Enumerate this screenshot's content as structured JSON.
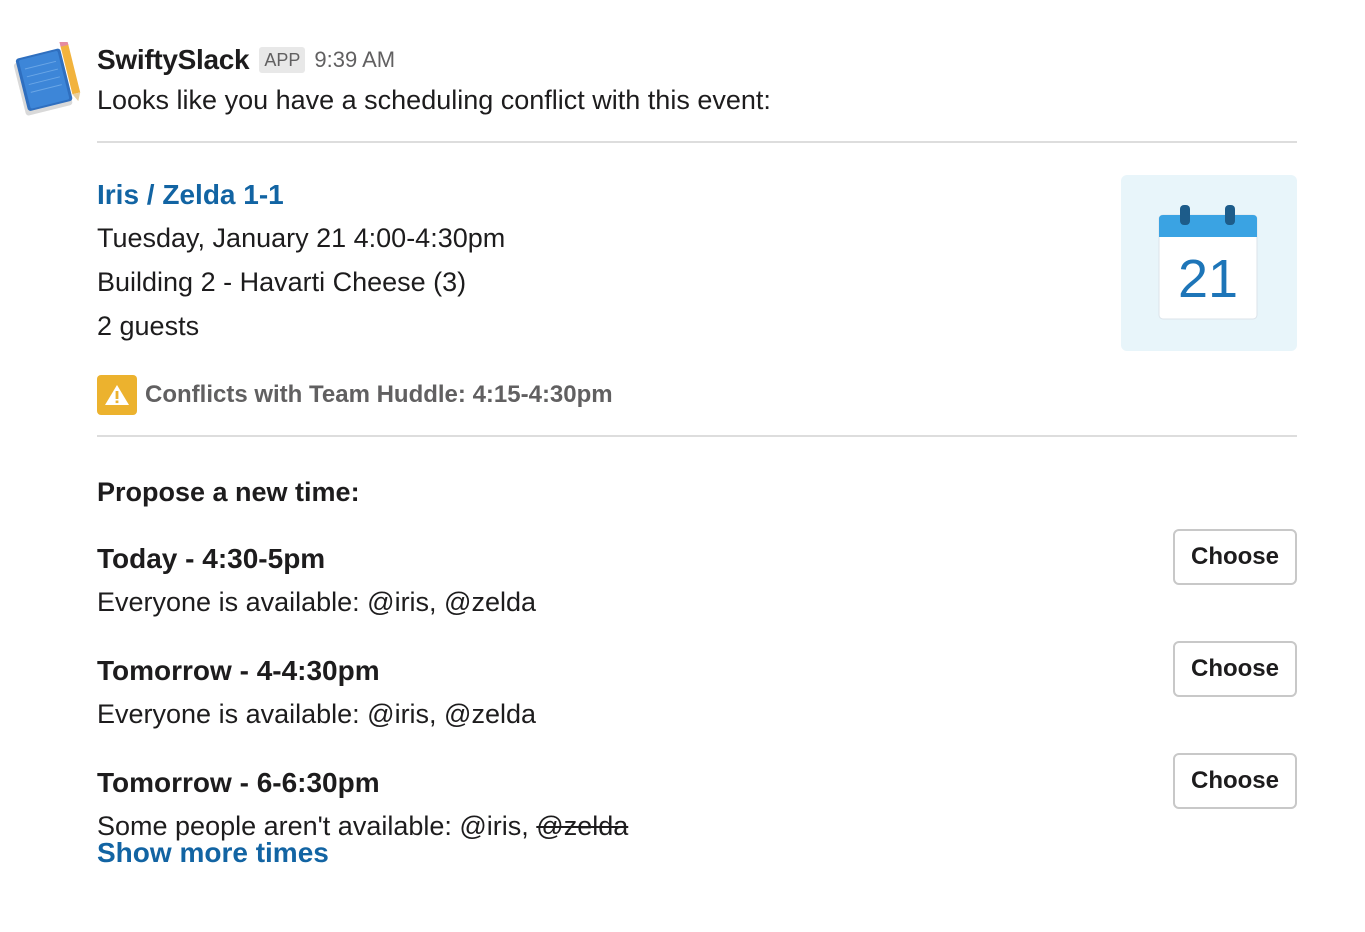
{
  "message": {
    "sender": "SwiftySlack",
    "badge": "APP",
    "timestamp": "9:39 AM",
    "intro": "Looks like you have a scheduling conflict with this event:",
    "avatar_icon": "notebook-pencil-icon"
  },
  "event": {
    "title": "Iris / Zelda 1-1",
    "datetime": "Tuesday, January 21 4:00-4:30pm",
    "location": "Building 2 - Havarti Cheese (3)",
    "guests": "2 guests",
    "calendar_day": "21",
    "calendar_icon": "calendar-icon",
    "conflict_icon": "warning-icon",
    "conflict_text": "Conflicts with Team Huddle: 4:15-4:30pm"
  },
  "propose": {
    "heading": "Propose a new time:",
    "options": [
      {
        "title": "Today - 4:30-5pm",
        "desc_prefix": "Everyone is available: ",
        "available": "@iris, @zelda",
        "unavailable": "",
        "button": "Choose"
      },
      {
        "title": "Tomorrow - 4-4:30pm",
        "desc_prefix": "Everyone is available: ",
        "available": "@iris, @zelda",
        "unavailable": "",
        "button": "Choose"
      },
      {
        "title": "Tomorrow - 6-6:30pm",
        "desc_prefix": "Some people aren't available: ",
        "available": "@iris, ",
        "unavailable": "@zelda",
        "button": "Choose"
      }
    ],
    "show_more": "Show more times"
  },
  "colors": {
    "link": "#1264a3",
    "warning": "#ecb22e",
    "calendar_bg": "#e8f5fa",
    "calendar_header": "#3aa3e3"
  }
}
